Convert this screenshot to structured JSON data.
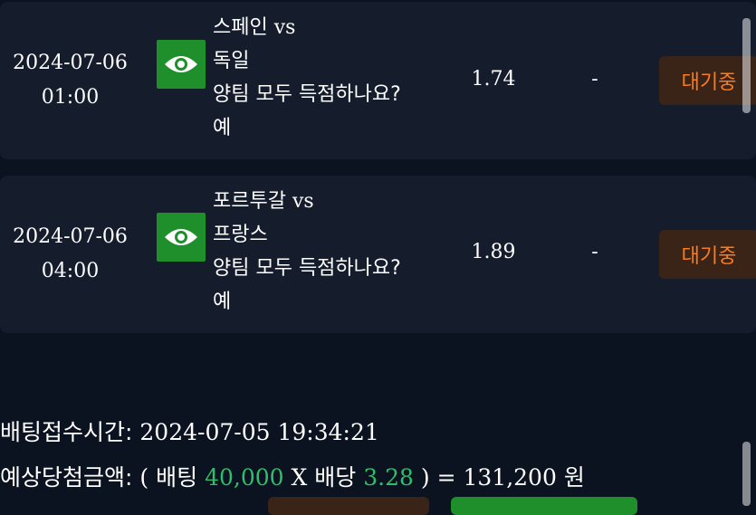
{
  "bets": [
    {
      "date": "2024-07-06",
      "time": "01:00",
      "home": "스페인",
      "vs": "vs",
      "away": "독일",
      "market": "양팀 모두 득점하나요?",
      "pick": "예",
      "odds": "1.74",
      "result": "-",
      "status": "대기중"
    },
    {
      "date": "2024-07-06",
      "time": "04:00",
      "home": "포르투갈",
      "vs": "vs",
      "away": "프랑스",
      "market": "양팀 모두 득점하나요?",
      "pick": "예",
      "odds": "1.89",
      "result": "-",
      "status": "대기중"
    }
  ],
  "summary": {
    "receipt_label": "배팅접수시간:",
    "receipt_time": "2024-07-05 19:34:21",
    "expected_label": "예상당첨금액:",
    "open_paren": "(",
    "bet_label": "배팅",
    "bet_amount": "40,000",
    "times": "X",
    "odds_label": "배당",
    "total_odds": "3.28",
    "close_eq": ") =",
    "payout": "131,200",
    "currency": "원"
  },
  "icons": {
    "view": "eye-icon"
  },
  "colors": {
    "status_text": "#ff7a1a",
    "status_bg": "#3a2418",
    "eye_bg": "#1f8f2c",
    "highlight": "#2fbf6a"
  }
}
